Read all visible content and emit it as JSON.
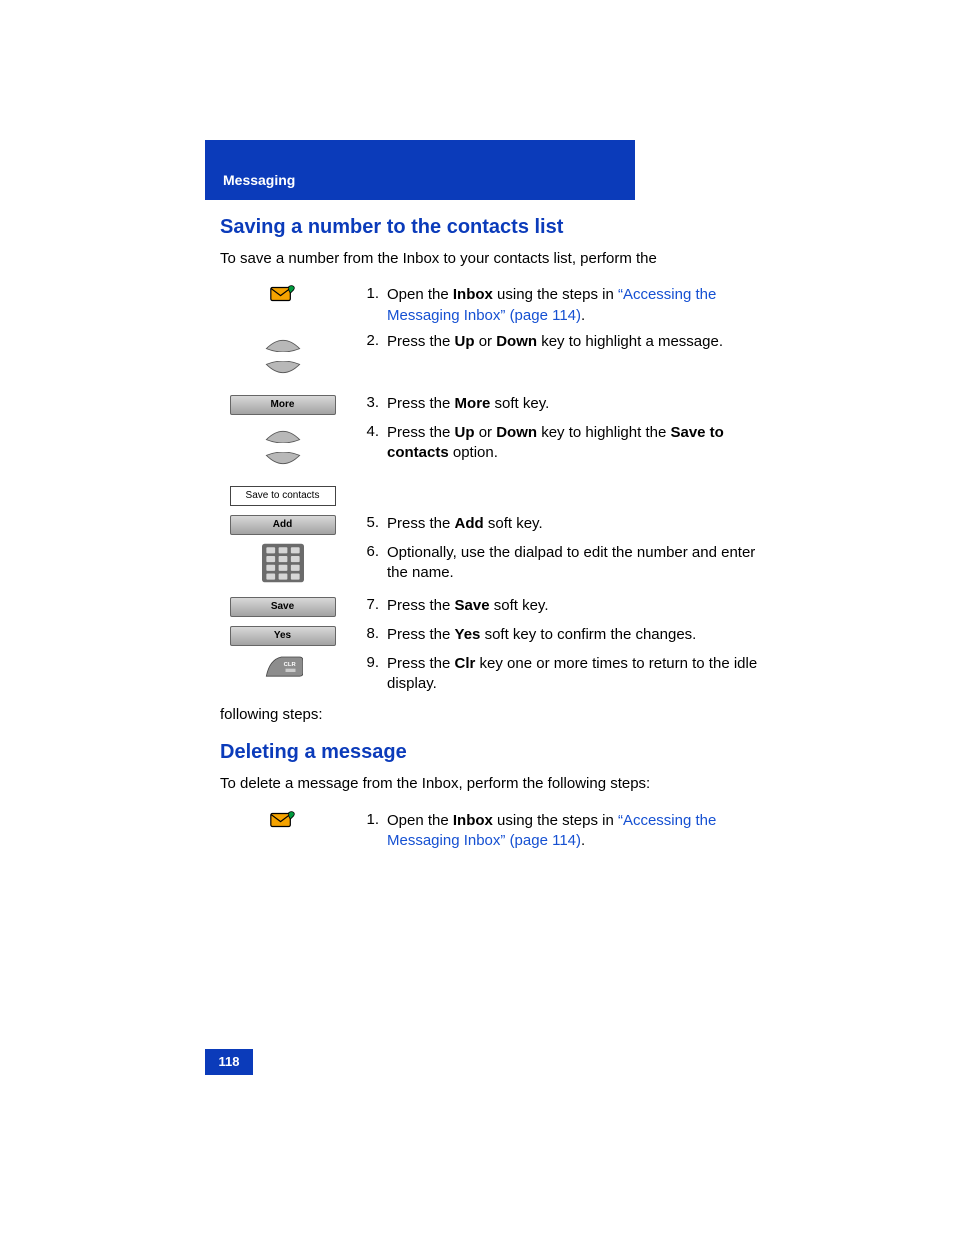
{
  "header": {
    "section_label": "Messaging"
  },
  "section1": {
    "title": "Saving a number to the contacts list",
    "intro": "To save a number from the Inbox to your contacts list, perform the",
    "trailing": "following steps:"
  },
  "section2": {
    "title": "Deleting a message",
    "intro": "To delete a message from the Inbox, perform the following steps:"
  },
  "steps1": {
    "s1": {
      "num": "1.",
      "pre": "Open the ",
      "bold": "Inbox",
      "post": " using the steps in ",
      "link": "“Accessing the Messaging Inbox” (page 114)",
      "tail": "."
    },
    "s2": {
      "num": "2.",
      "pre": "Press the ",
      "b1": "Up",
      "mid": " or ",
      "b2": "Down",
      "post": " key to highlight a message."
    },
    "s3": {
      "num": "3.",
      "pre": "Press the ",
      "b1": "More",
      "post": " soft key.",
      "key_label": "More"
    },
    "s4": {
      "num": "4.",
      "pre": "Press the ",
      "b1": "Up",
      "mid": " or ",
      "b2": "Down",
      "post": " key to highlight the ",
      "opt": "Save to contacts",
      "tail": " option.",
      "key_label": "Save to contacts"
    },
    "s5": {
      "num": "5.",
      "pre": "Press the ",
      "b1": "Add",
      "post": " soft key.",
      "key_label": "Add"
    },
    "s6": {
      "num": "6.",
      "text": "Optionally, use the dialpad to edit the number and enter the name."
    },
    "s7": {
      "num": "7.",
      "pre": "Press the ",
      "b1": "Save",
      "post": " soft key.",
      "key_label": "Save"
    },
    "s8": {
      "num": "8.",
      "pre": "Press the ",
      "b1": "Yes",
      "post": " soft key to confirm the changes.",
      "key_label": "Yes"
    },
    "s9": {
      "num": "9.",
      "pre": "Press the ",
      "b1": "Clr",
      "post": " key one or more times to return to the idle display."
    }
  },
  "steps2": {
    "s1": {
      "num": "1.",
      "pre": "Open the ",
      "bold": "Inbox",
      "post": " using the steps in ",
      "link": "“Accessing the Messaging Inbox” (page 114)",
      "tail": "."
    }
  },
  "footer": {
    "page_number": "118"
  }
}
